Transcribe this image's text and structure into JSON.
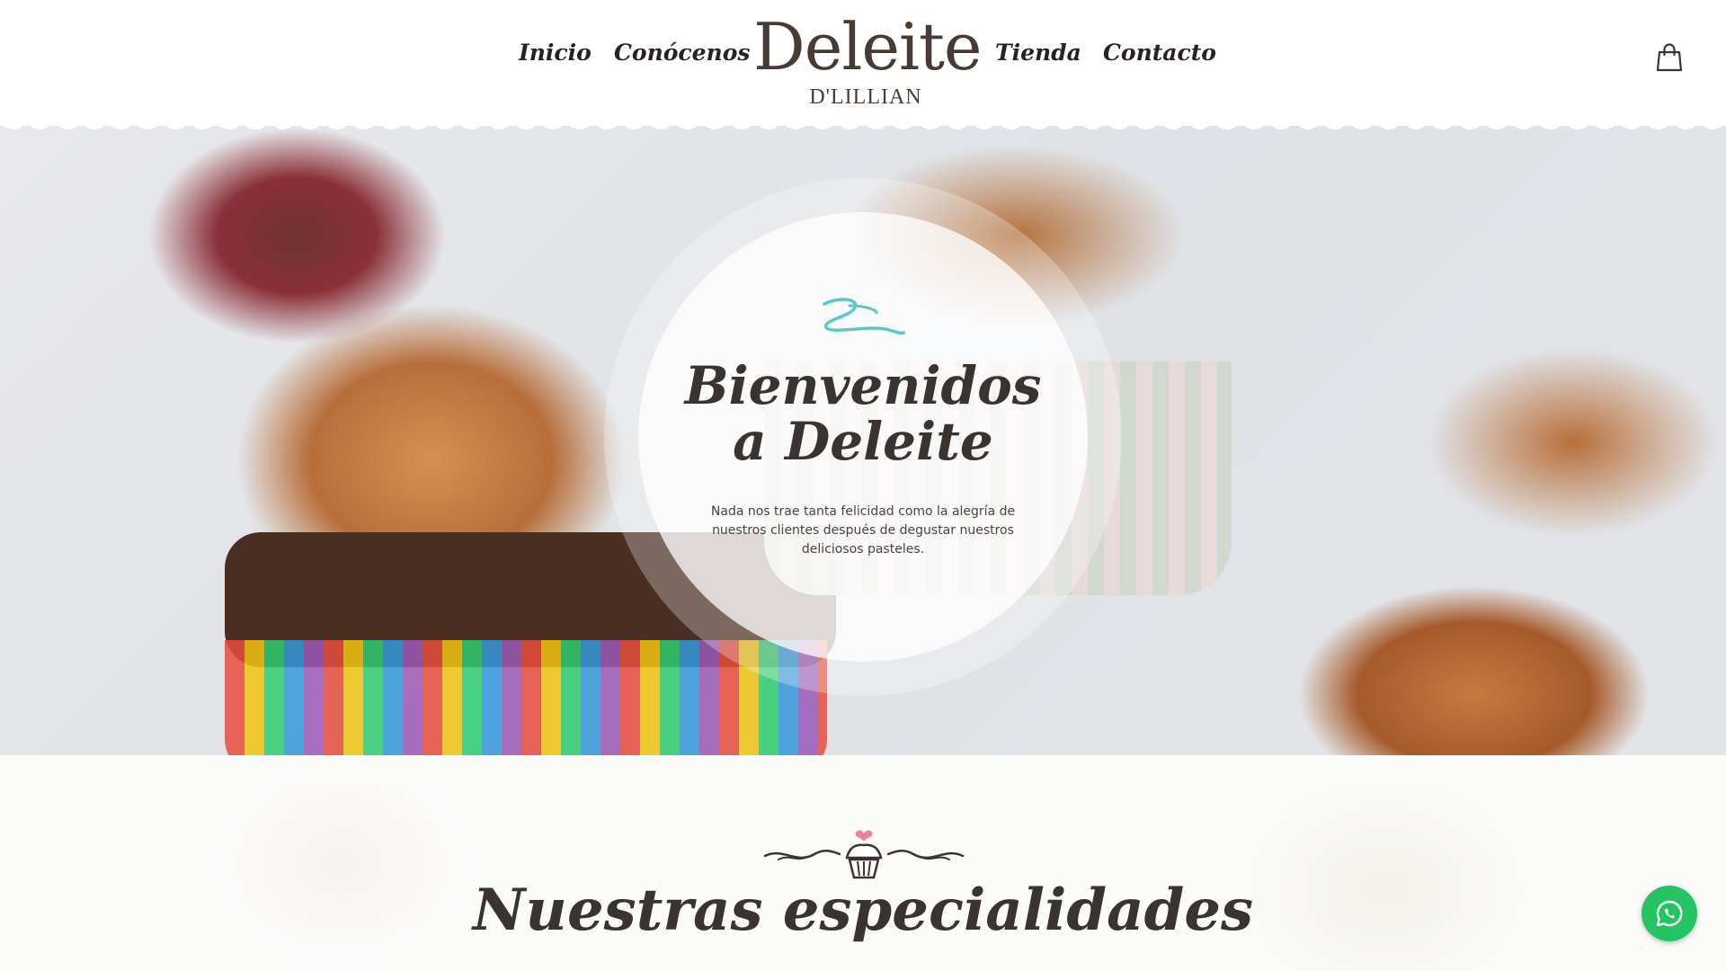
{
  "nav": {
    "items": [
      {
        "label": "Inicio"
      },
      {
        "label": "Conócenos"
      },
      {
        "label": "Tienda"
      },
      {
        "label": "Contacto"
      }
    ],
    "cart_icon": "shopping-bag-icon"
  },
  "logo": {
    "main": "Deleite",
    "sub": "D'LILLIAN"
  },
  "hero": {
    "title_line1": "Bienvenidos",
    "title_line2": "a Deleite",
    "text": "Nada nos trae tanta felicidad como la alegría de nuestros clientes después de degustar nuestros deliciosos pasteles.",
    "swirl_icon": "swirl-ornament-icon",
    "accent_color": "#5bc8c8"
  },
  "specialties": {
    "title": "Nuestras especialidades",
    "ornament_icon": "cupcake-ornament-icon",
    "heart_color": "#f07ea0"
  },
  "whatsapp": {
    "icon": "whatsapp-icon",
    "color": "#25c462"
  }
}
